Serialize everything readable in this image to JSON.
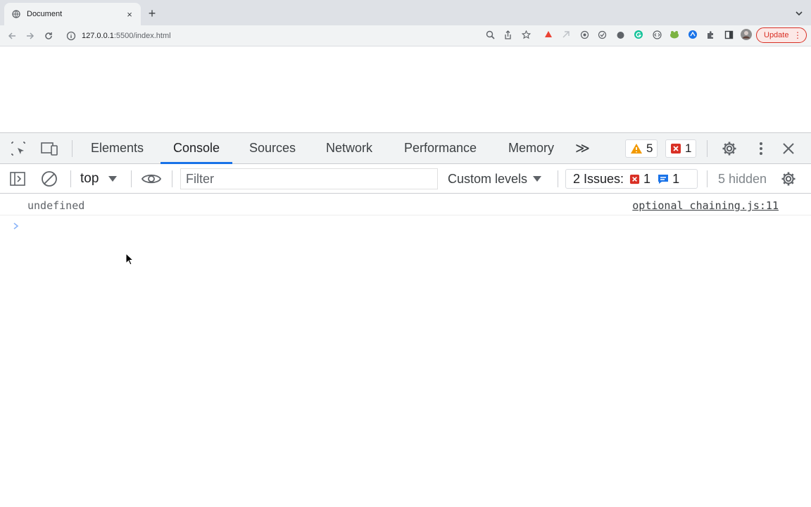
{
  "browser": {
    "tab_title": "Document",
    "close_glyph": "×",
    "newtab_glyph": "+",
    "url_host": "127.0.0.1",
    "url_path": ":5500/index.html",
    "update_label": "Update",
    "update_menu_glyph": "⋮",
    "extensions": [
      "zoom-icon",
      "share-icon",
      "star-icon",
      "ext-red-icon",
      "ext-gray-icon",
      "ext-circle-icon",
      "ext-check-icon",
      "ext-dark-icon",
      "grammarly-icon",
      "ext-code-icon",
      "ext-frog-icon",
      "ext-blue-icon",
      "puzzle-icon",
      "sidepanel-icon",
      "profile-avatar"
    ]
  },
  "devtools": {
    "tabs": [
      "Elements",
      "Console",
      "Sources",
      "Network",
      "Performance",
      "Memory"
    ],
    "more_tabs_glyph": "≫",
    "active_tab": "Console",
    "warning_count": "5",
    "error_count": "1",
    "context": "top",
    "filter_placeholder": "Filter",
    "levels_label": "Custom levels",
    "issues_label": "2 Issues:",
    "issues_error_count": "1",
    "issues_info_count": "1",
    "hidden_label": "5 hidden"
  },
  "console": {
    "messages": [
      {
        "text": "undefined",
        "source": "optional chaining.js:11"
      }
    ]
  },
  "colors": {
    "accent": "#1a73e8",
    "error": "#d93025",
    "warning": "#f29900",
    "info": "#1a73e8"
  }
}
